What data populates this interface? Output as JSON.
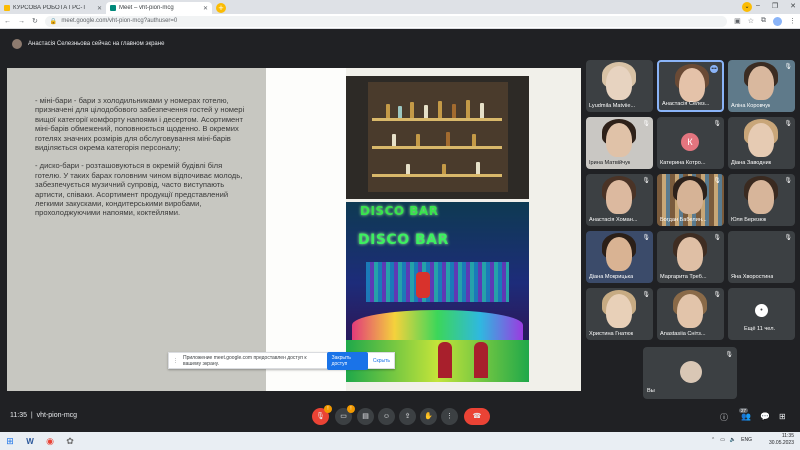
{
  "browser": {
    "tabs": [
      {
        "title": "КУРСОВА РОБОТА ГРС-Т",
        "active": false,
        "color": "#fbbc04"
      },
      {
        "title": "Meet – vht-pion-mcg",
        "active": true,
        "color": "#00897b"
      }
    ],
    "url": "meet.google.com/vht-pion-mcg?authuser=0"
  },
  "meet": {
    "presenting_banner": "Анастасія Селезньова сейчас на главном экране",
    "slide": {
      "paragraph1": "-    міні-бари - бари з холодильниками у номерах готелю, призначені для цілодобового забезпечення гостей у номері вищої категорії комфорту напоями і десертом. Асортимент міні-барів обмежений, поповнюється щоденно. В окремих готелях значних розмірів для обслуговування міні-барів виділяється окрема категорія персоналу;",
      "paragraph2": "-    диско-бари - розташовуються в окремій будівлі біля готелю. У таких барах головним чином відпочиває молодь, забезпечується музичний супровід, часто виступають артисти, співаки. Асортимент продукції представлений легкими закусками, кондитерськими виробами, прохолоджуючими напоями, коктейлями.",
      "sign_top": "DISCO BAR",
      "sign_bottom": "DISCO BAR"
    },
    "toast": {
      "text": "Приложение meet.google.com предоставлен доступ к вашему экрану.",
      "stop_label": "Закрыть доступ",
      "hide_label": "Скрыть"
    },
    "participants": [
      {
        "name": "Lyudmila Matviie..."
      },
      {
        "name": "Анастасія Селез..."
      },
      {
        "name": "Аліна Коровчук"
      },
      {
        "name": "Ірина Матвійчук"
      },
      {
        "name": "Катерина Котро...",
        "initial": "К"
      },
      {
        "name": "Діана Заводник"
      },
      {
        "name": "Анастасія Хоман..."
      },
      {
        "name": "Богдан Бабелин..."
      },
      {
        "name": "Юля Березюк"
      },
      {
        "name": "Діана Мокрицька"
      },
      {
        "name": "Маргарита Треб..."
      },
      {
        "name": "Яна Хворостина"
      },
      {
        "name": "Христина Гнатюк"
      },
      {
        "name": "Anastasiia Снітз..."
      },
      {
        "name": "Ещё 11 чел."
      }
    ],
    "self_label": "Вы",
    "time": "11:35",
    "meeting_code": "vht-pion-mcg",
    "participant_count": "27"
  },
  "taskbar": {
    "lang": "ENG",
    "clock_time": "11:35",
    "clock_date": "30.05.2023"
  }
}
